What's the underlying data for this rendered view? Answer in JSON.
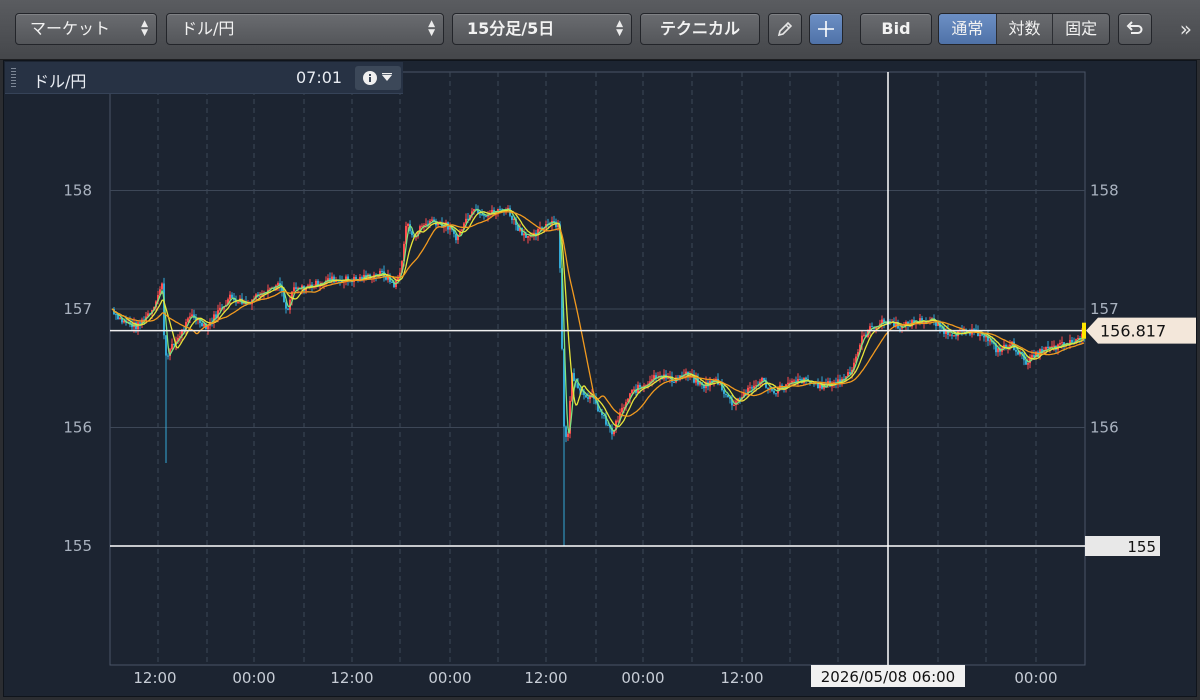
{
  "toolbar": {
    "market_select": "マーケット",
    "pair_select": "ドル/円",
    "interval_select": "15分足/5日",
    "technical_button": "テクニカル",
    "pencil_icon": "pencil-icon",
    "crosshair_icon": "crosshair-icon",
    "bid_button": "Bid",
    "scale_modes": [
      "通常",
      "対数",
      "固定"
    ],
    "active_scale_mode": "通常",
    "undo_icon": "undo-arrow-icon",
    "more_icon": "double-chevron-right-icon"
  },
  "info_box": {
    "symbol": "ドル/円",
    "time": "07:01",
    "info_icon": "info-icon"
  },
  "colors": {
    "background": "#1c2431",
    "grid": "#3d4757",
    "candle_up": "#ff4d4d",
    "candle_down": "#33a9d6",
    "ma_short": "#7fe37f",
    "ma_mid": "#e8e53a",
    "ma_long": "#f29a1f",
    "crosshair": "#ffffff",
    "price_tag_bg": "#f3e7da"
  },
  "chart_data": {
    "type": "candlestick",
    "ylim": [
      154.0,
      158.7
    ],
    "y_ticks": [
      "155",
      "156",
      "157",
      "158"
    ],
    "x_tick_labels": [
      "12:00",
      "00:00",
      "12:00",
      "00:00",
      "12:00",
      "00:00",
      "12:00",
      "",
      "00:00"
    ],
    "current_price_label": "156.817",
    "current_price": 156.817,
    "crosshair_price_label": "155",
    "crosshair_price": 155.0,
    "crosshair_time_label": "2026/05/08 06:00",
    "series_ma": [
      {
        "color_key": "ma_short"
      },
      {
        "color_key": "ma_mid"
      },
      {
        "color_key": "ma_long"
      }
    ],
    "price_path": [
      [
        0,
        157.0
      ],
      [
        10,
        156.9
      ],
      [
        25,
        156.85
      ],
      [
        40,
        157.0
      ],
      [
        50,
        157.2
      ],
      [
        53,
        156.6
      ],
      [
        58,
        156.65
      ],
      [
        80,
        156.95
      ],
      [
        95,
        156.85
      ],
      [
        108,
        157.0
      ],
      [
        118,
        157.1
      ],
      [
        135,
        157.05
      ],
      [
        150,
        157.15
      ],
      [
        168,
        157.2
      ],
      [
        175,
        156.95
      ],
      [
        180,
        157.15
      ],
      [
        200,
        157.2
      ],
      [
        220,
        157.25
      ],
      [
        245,
        157.25
      ],
      [
        270,
        157.3
      ],
      [
        283,
        157.2
      ],
      [
        288,
        157.3
      ],
      [
        295,
        157.75
      ],
      [
        300,
        157.6
      ],
      [
        310,
        157.7
      ],
      [
        320,
        157.75
      ],
      [
        335,
        157.7
      ],
      [
        345,
        157.6
      ],
      [
        360,
        157.85
      ],
      [
        375,
        157.8
      ],
      [
        395,
        157.85
      ],
      [
        405,
        157.7
      ],
      [
        410,
        157.65
      ],
      [
        420,
        157.6
      ],
      [
        432,
        157.7
      ],
      [
        440,
        157.75
      ],
      [
        447,
        157.7
      ],
      [
        452,
        156.0
      ],
      [
        455,
        155.85
      ],
      [
        460,
        156.45
      ],
      [
        470,
        156.3
      ],
      [
        480,
        156.25
      ],
      [
        490,
        156.1
      ],
      [
        500,
        155.95
      ],
      [
        510,
        156.15
      ],
      [
        520,
        156.3
      ],
      [
        530,
        156.35
      ],
      [
        545,
        156.45
      ],
      [
        560,
        156.4
      ],
      [
        575,
        156.45
      ],
      [
        590,
        156.35
      ],
      [
        605,
        156.4
      ],
      [
        620,
        156.2
      ],
      [
        635,
        156.3
      ],
      [
        650,
        156.4
      ],
      [
        660,
        156.3
      ],
      [
        672,
        156.35
      ],
      [
        690,
        156.4
      ],
      [
        710,
        156.35
      ],
      [
        730,
        156.4
      ],
      [
        740,
        156.5
      ],
      [
        750,
        156.75
      ],
      [
        760,
        156.85
      ],
      [
        775,
        156.9
      ],
      [
        790,
        156.85
      ],
      [
        805,
        156.9
      ],
      [
        820,
        156.9
      ],
      [
        835,
        156.8
      ],
      [
        850,
        156.8
      ],
      [
        870,
        156.8
      ],
      [
        885,
        156.65
      ],
      [
        900,
        156.7
      ],
      [
        915,
        156.55
      ],
      [
        930,
        156.65
      ],
      [
        945,
        156.68
      ],
      [
        960,
        156.72
      ],
      [
        972,
        156.78
      ]
    ]
  }
}
